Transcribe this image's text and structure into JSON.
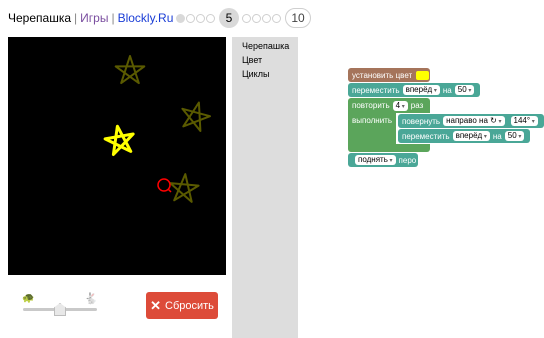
{
  "header": {
    "app_title": "Черепашка",
    "games_link": "Игры",
    "brand_link": "Blockly.Ru",
    "current_level": "5",
    "last_level": "10"
  },
  "colors": {
    "accent_red": "#dd4b39",
    "canvas_bg": "#000000",
    "star_yellow": "#ffff00",
    "star_dim": "#5a5a00",
    "turtle_red": "#ff0000",
    "brown": "#a5745b",
    "teal": "#4aa797",
    "loop_green": "#5ba55b"
  },
  "speed": {
    "slow_icon": "turtle-icon",
    "fast_icon": "rabbit-icon",
    "level": 0.5
  },
  "reset_button": {
    "icon": "close-icon",
    "label": "Сбросить"
  },
  "toolbox": {
    "categories": [
      "Черепашка",
      "Цвет",
      "Циклы"
    ]
  },
  "blocks": {
    "set_color": {
      "label": "установить цвет",
      "color_value": "#ffff00"
    },
    "move1": {
      "label": "переместить",
      "direction": "вперёд",
      "on": "на",
      "value": "50"
    },
    "repeat": {
      "label": "повторить",
      "count": "4",
      "times": "раз",
      "do": "выполнить"
    },
    "turn": {
      "label": "повернуть",
      "direction": "направо на ↻",
      "angle": "144°"
    },
    "move2": {
      "label": "переместить",
      "direction": "вперёд",
      "on": "на",
      "value": "50"
    },
    "pen": {
      "mode": "поднять",
      "label": "перо"
    }
  }
}
